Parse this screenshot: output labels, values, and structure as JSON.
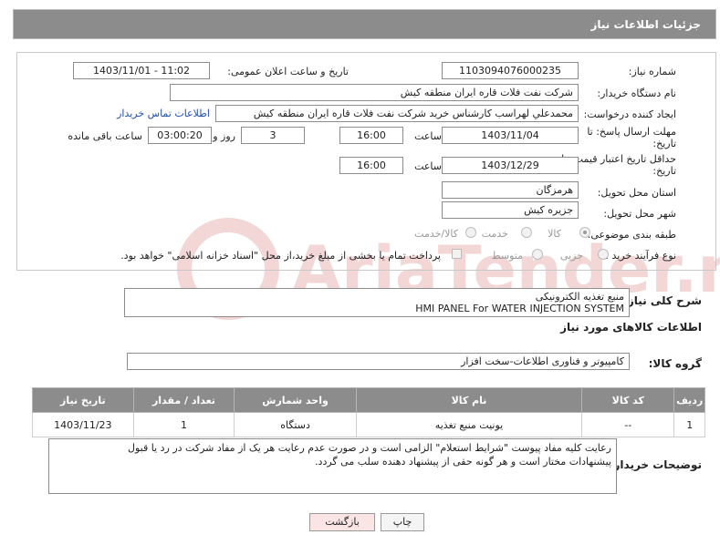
{
  "page": {
    "title": "جزئیات اطلاعات نیاز"
  },
  "need_number": {
    "label": "شماره نیاز:",
    "value": "1103094076000235"
  },
  "announce": {
    "label": "تاریخ و ساعت اعلان عمومی:",
    "value": "1403/11/01 - 11:02"
  },
  "buyer_org": {
    "label": "نام دستگاه خریدار:",
    "value": "شرکت نفت فلات قاره ایران منطقه کیش"
  },
  "requester": {
    "label": "ایجاد کننده درخواست:",
    "value": "محمدعلي لهراسب کارشناس خريد شرکت نفت فلات قاره ايران منطقه کيش",
    "contact_link": "اطلاعات تماس خریدار"
  },
  "deadline": {
    "label_line1": "مهلت ارسال پاسخ: تا",
    "label_line2": "تاریخ:",
    "date": "1403/11/04",
    "time_label": "ساعت",
    "time": "16:00",
    "days": "3",
    "days_label": "روز و",
    "remaining": "03:00:20",
    "remaining_label": "ساعت باقی مانده"
  },
  "price_validity": {
    "label_line1": "حداقل تاریخ اعتبار قیمت: تا",
    "label_line2": "تاریخ:",
    "date": "1403/12/29",
    "time_label": "ساعت",
    "time": "16:00"
  },
  "province": {
    "label": "استان محل تحویل:",
    "value": "هرمزگان"
  },
  "city": {
    "label": "شهر محل تحویل:",
    "value": "جزیره کیش"
  },
  "category": {
    "label": "طبقه بندی موضوعی:",
    "options": [
      "کالا",
      "خدمت",
      "کالا/خدمت"
    ],
    "selected": "کالا"
  },
  "process": {
    "label": "نوع فرآیند خرید :",
    "options": [
      "جزیی",
      "متوسط"
    ],
    "checkbox_text": "پرداخت تمام یا بخشی از مبلغ خرید،از محل \"اسناد خزانه اسلامی\" خواهد بود."
  },
  "description": {
    "label": "شرح کلی نیاز:",
    "line1": "منبع تغذیه الکترونیکی",
    "line2": "HMI PANEL For WATER INJECTION SYSTEM"
  },
  "goods_info": {
    "title": "اطلاعات کالاهای مورد نیاز"
  },
  "goods_group": {
    "label": "گروه کالا:",
    "value": "کامپیوتر و فناوری اطلاعات-سخت افزار"
  },
  "table": {
    "headers": [
      "ردیف",
      "کد کالا",
      "نام کالا",
      "واحد شمارش",
      "تعداد / مقدار",
      "تاریخ نیاز"
    ],
    "rows": [
      [
        "1",
        "--",
        "یونیت منبع تغذیه",
        "دستگاه",
        "1",
        "1403/11/23"
      ]
    ]
  },
  "buyer_notes": {
    "label": "توضیحات خریدار:",
    "line1": "رعایت کلیه مفاد  پیوست \"شرایط استعلام\" الزامی است و در صورت عدم رعایت هر یک از مفاد شرکت در رد یا قبول",
    "line2": "پیشنهادات مختار است  و هر گونه حقی از پیشنهاد دهنده سلب می گردد."
  },
  "buttons": {
    "print": "چاپ",
    "back": "بازگشت"
  },
  "watermark": {
    "text": "AriaTender.neT"
  },
  "colors": {
    "header_bg": "#8c8c8c",
    "back_button_bg": "#fbe4e4",
    "link": "#1f4fb2"
  }
}
